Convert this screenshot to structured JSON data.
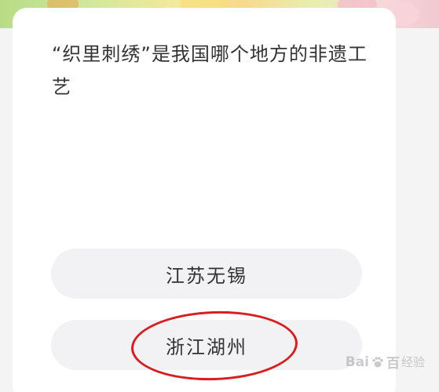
{
  "question": {
    "text": "“织里刺绣”是我国哪个地方的非遗工艺"
  },
  "options": [
    {
      "label": "江苏无锡"
    },
    {
      "label": "浙江湖州"
    }
  ],
  "watermark": {
    "brand": "Bai",
    "brand_suffix": "百",
    "sub": "经验"
  },
  "colors": {
    "highlight": "#d81e1e",
    "option_bg": "#f2f2f4",
    "text": "#333333"
  }
}
